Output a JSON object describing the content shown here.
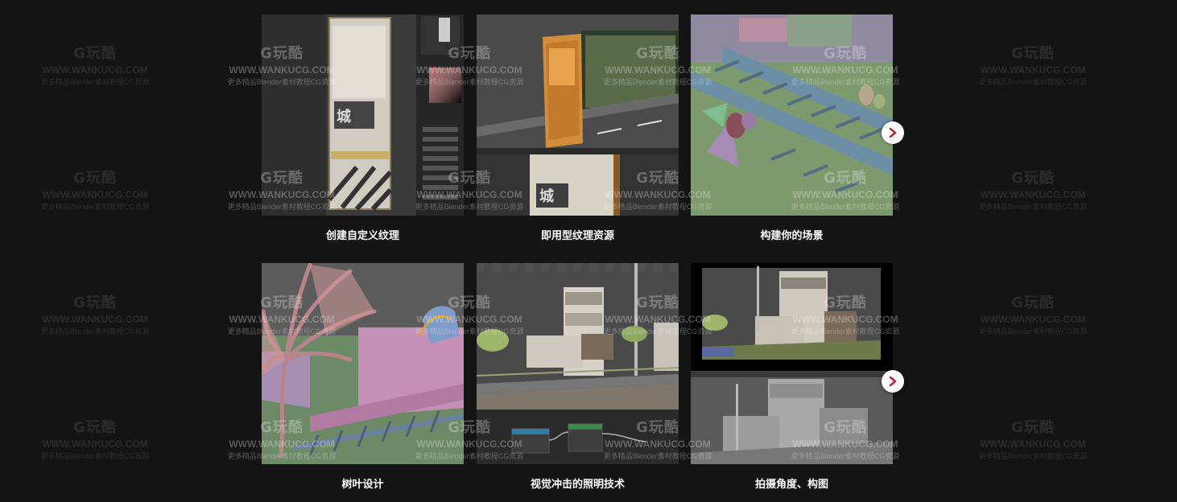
{
  "watermark": {
    "logo": "G玩酷",
    "url": "WWW.WANKUCG.COM",
    "tagline": "更多精品Blender素材教程CG资源"
  },
  "gallery": {
    "items": [
      {
        "caption": "创建自定义纹理"
      },
      {
        "caption": "即用型纹理资源"
      },
      {
        "caption": "构建你的场景"
      },
      {
        "caption": "树叶设计"
      },
      {
        "caption": "视觉冲击的照明技术"
      },
      {
        "caption": "拍摄角度、构图"
      }
    ],
    "next_icon": "chevron-right-icon",
    "accent_color": "#c8102e"
  }
}
